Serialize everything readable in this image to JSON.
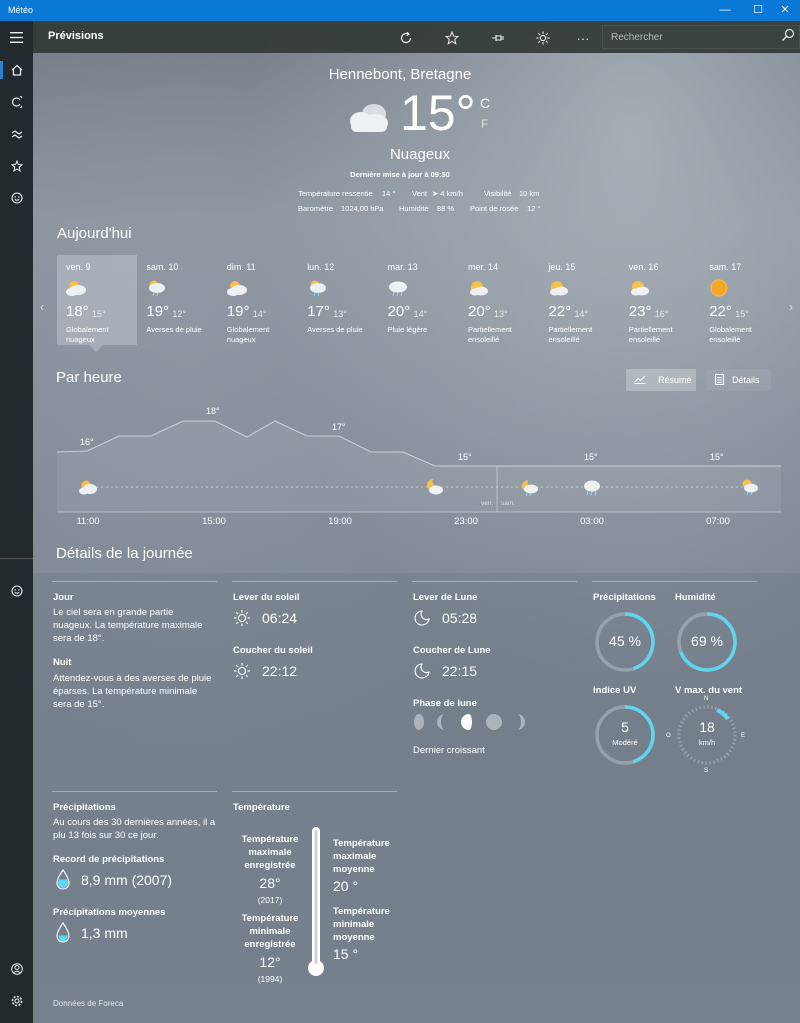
{
  "window": {
    "title": "Météo",
    "minimize": "—",
    "maximize": "☐",
    "close": "✕"
  },
  "header": {
    "app_title": "Prévisions",
    "more": "···",
    "search_placeholder": "Rechercher"
  },
  "sidebar": {
    "items": [
      "menu",
      "home",
      "radar",
      "historical",
      "favorites",
      "feedback"
    ]
  },
  "current": {
    "location": "Hennebont, Bretagne",
    "temp": "15°",
    "unit_c": "C",
    "unit_f": "F",
    "condition": "Nuageux",
    "updated": "Dernière mise à jour à 09:50",
    "stats": {
      "feels_label": "Température ressentie",
      "feels_value": "14 °",
      "wind_label": "Vent",
      "wind_value": "➤ 4 km/h",
      "visibility_label": "Visibilité",
      "visibility_value": "10 km",
      "pressure_label": "Baromètre",
      "pressure_value": "1024,00 hPa",
      "humidity_label": "Humidité",
      "humidity_value": "88 %",
      "dew_label": "Point de rosée",
      "dew_value": "12 °"
    }
  },
  "today_title": "Aujourd'hui",
  "days": [
    {
      "name": "ven. 9",
      "hi": "18°",
      "lo": "15°",
      "desc": "Globalement nuageux",
      "icon": "partly-cloudy"
    },
    {
      "name": "sam. 10",
      "hi": "19°",
      "lo": "12°",
      "desc": "Averses de pluie",
      "icon": "showers"
    },
    {
      "name": "dim. 11",
      "hi": "19°",
      "lo": "14°",
      "desc": "Globalement nuageux",
      "icon": "partly-cloudy"
    },
    {
      "name": "lun. 12",
      "hi": "17°",
      "lo": "13°",
      "desc": "Averses de pluie",
      "icon": "showers"
    },
    {
      "name": "mar. 13",
      "hi": "20°",
      "lo": "14°",
      "desc": "Pluie légère",
      "icon": "rain"
    },
    {
      "name": "mer. 14",
      "hi": "20°",
      "lo": "13°",
      "desc": "Partiellement ensoleillé",
      "icon": "partly-sunny"
    },
    {
      "name": "jeu. 15",
      "hi": "22°",
      "lo": "14°",
      "desc": "Partiellement ensoleillé",
      "icon": "partly-sunny"
    },
    {
      "name": "ven. 16",
      "hi": "23°",
      "lo": "16°",
      "desc": "Partiellement ensoleillé",
      "icon": "partly-sunny"
    },
    {
      "name": "sam. 17",
      "hi": "22°",
      "lo": "15°",
      "desc": "Globalement ensoleillé",
      "icon": "sunny"
    }
  ],
  "hourly_title": "Par heure",
  "hourly_buttons": {
    "summary": "Résumé",
    "details": "Détails"
  },
  "hourly": {
    "temp_labels": [
      "16°",
      "18°",
      "17°",
      "15°",
      "15°",
      "15°"
    ],
    "hours": [
      "11:00",
      "15:00",
      "19:00",
      "23:00",
      "03:00",
      "07:00"
    ],
    "day_marks": [
      "ven.",
      "sam."
    ]
  },
  "details_title": "Détails de la journée",
  "details": {
    "day_label": "Jour",
    "day_text": "Le ciel sera en grande partie nuageux. La température maximale sera de 18°.",
    "night_label": "Nuit",
    "night_text": "Attendez-vous à des averses de pluie éparses. La température minimale sera de 15°.",
    "sunrise_label": "Lever du soleil",
    "sunrise": "06:24",
    "sunset_label": "Coucher du soleil",
    "sunset": "22:12",
    "moonrise_label": "Lever de Lune",
    "moonrise": "05:28",
    "moonset_label": "Coucher de Lune",
    "moonset": "22:15",
    "moonphase_label": "Phase de lune",
    "moonphase": "Dernier croissant",
    "precip_label": "Précipitations",
    "precip_value": "45 %",
    "precip_pct": 45,
    "humidity_label": "Humidité",
    "humidity_value": "69 %",
    "humidity_pct": 69,
    "uv_label": "Indice UV",
    "uv_value": "5",
    "uv_desc": "Modéré",
    "uv_fraction": 0.45,
    "wind_label": "V max. du vent",
    "wind_value": "18",
    "wind_unit": "km/h",
    "compass": {
      "n": "N",
      "e": "E",
      "s": "S",
      "o": "O"
    }
  },
  "history": {
    "precip_label": "Précipitations",
    "precip_text": "Au cours des 30 dernières années, il a plu 13 fois sur 30 ce jour.",
    "record_label": "Record de précipitations",
    "record_value": "8,9 mm (2007)",
    "avg_label": "Précipitations moyennes",
    "avg_value": "1,3 mm",
    "temp_label": "Température",
    "max_rec_label": "Température maximale enregistrée",
    "max_rec_value": "28°",
    "max_rec_year": "(2017)",
    "min_rec_label": "Température minimale enregistrée",
    "min_rec_value": "12°",
    "min_rec_year": "(1994)",
    "max_avg_label": "Température maximale moyenne",
    "max_avg_value": "20 °",
    "min_avg_label": "Température minimale moyenne",
    "min_avg_value": "15 °"
  },
  "credit": "Données de Foreca",
  "colors": {
    "accent": "#5fd6f0",
    "titlebar": "#0a78d7",
    "sidebar": "#222a2d"
  }
}
